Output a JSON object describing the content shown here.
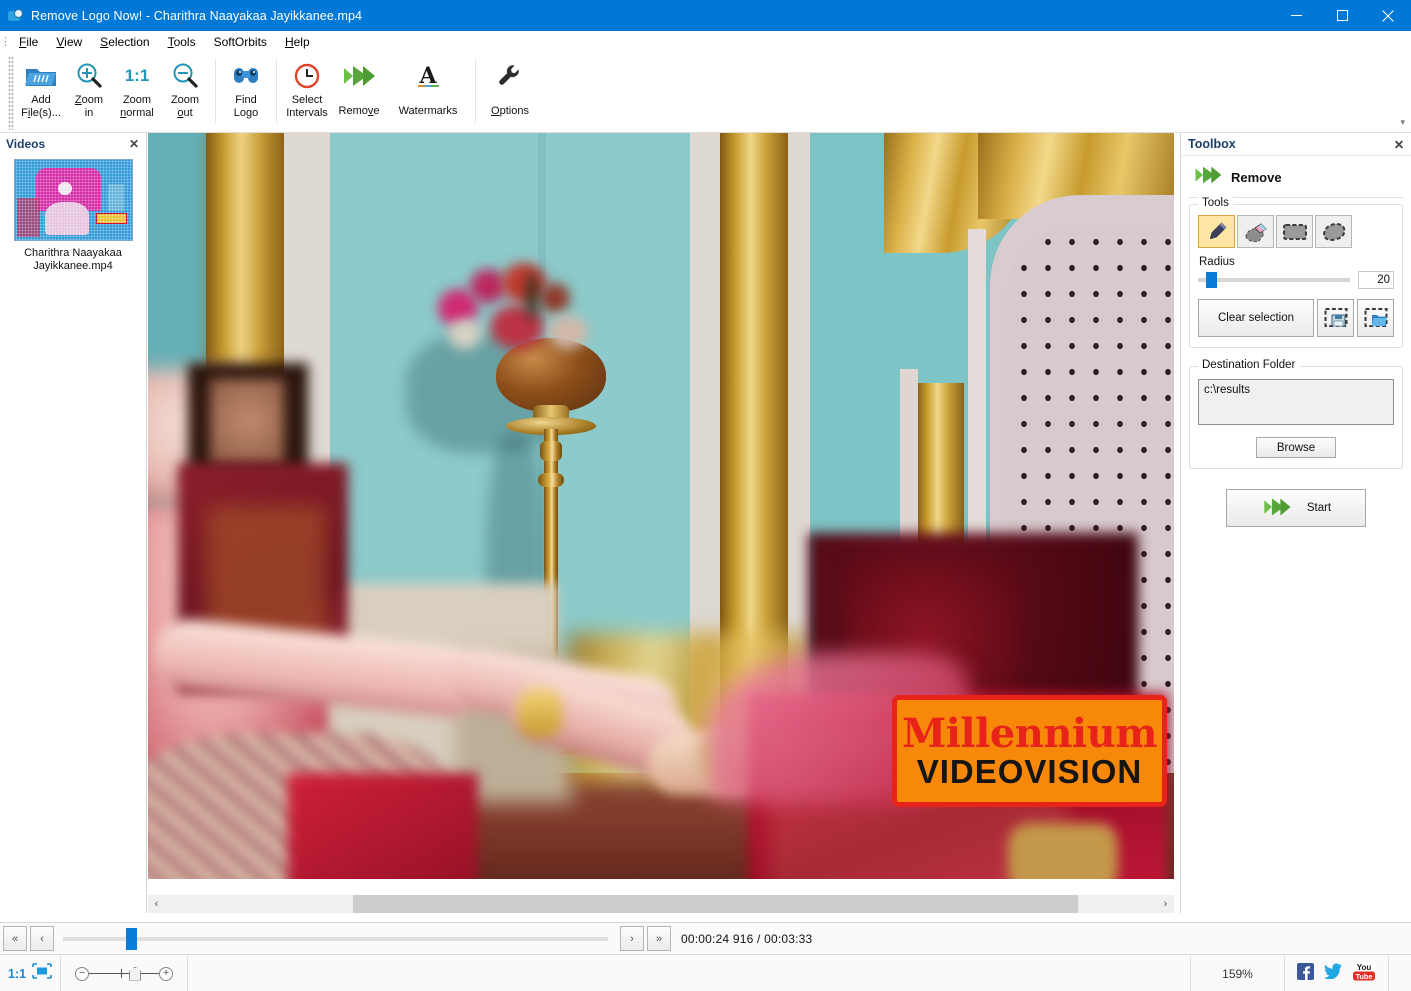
{
  "window": {
    "title": "Remove Logo Now! - Charithra Naayakaa Jayikkanee.mp4",
    "app_icon": "app-logo-icon",
    "minimize": "—",
    "maximize": "□",
    "close": "✕"
  },
  "menubar": {
    "grip": "⋮",
    "items": [
      {
        "label": "File",
        "accel": "F"
      },
      {
        "label": "View",
        "accel": "V"
      },
      {
        "label": "Selection",
        "accel": "S"
      },
      {
        "label": "Tools",
        "accel": "T"
      },
      {
        "label": "SoftOrbits",
        "accel": ""
      },
      {
        "label": "Help",
        "accel": "H"
      }
    ]
  },
  "toolbar": {
    "expand_glyph": "▾",
    "items": [
      {
        "id": "add-files",
        "line1": "Add",
        "line2": "File(s)...",
        "icon": "open-folder-icon"
      },
      {
        "id": "zoom-in",
        "line1": "Zoom",
        "line2": "in",
        "icon": "zoom-in-icon"
      },
      {
        "id": "zoom-normal",
        "line1": "Zoom",
        "line2": "normal",
        "icon": "zoom-1to1-icon"
      },
      {
        "id": "zoom-out",
        "line1": "Zoom",
        "line2": "out",
        "icon": "zoom-out-icon"
      },
      {
        "id": "find-logo",
        "line1": "Find",
        "line2": "Logo",
        "icon": "binoculars-icon"
      },
      {
        "id": "select-intervals",
        "line1": "Select",
        "line2": "Intervals",
        "icon": "clock-icon"
      },
      {
        "id": "remove",
        "line1": "Remove",
        "line2": "",
        "icon": "green-arrow-icon"
      },
      {
        "id": "watermarks",
        "line1": "Watermarks",
        "line2": "",
        "icon": "letter-a-icon"
      },
      {
        "id": "options",
        "line1": "Options",
        "line2": "",
        "icon": "wrench-icon"
      }
    ]
  },
  "videos_panel": {
    "title": "Videos",
    "close_glyph": "✕",
    "item": {
      "filename_line1": "Charithra Naayakaa",
      "filename_line2": "Jayikkanee.mp4"
    }
  },
  "canvas": {
    "scrollbar": {
      "left_glyph": "‹",
      "right_glyph": "›"
    },
    "watermark": {
      "line1": "Millennium",
      "line2": "VIDEOVISION",
      "bg_color": "#f7880a",
      "border_color": "#e8231a",
      "line1_color": "#e8231a",
      "line2_color": "#151515"
    }
  },
  "toolbox": {
    "title": "Toolbox",
    "close_glyph": "✕",
    "mode_label": "Remove",
    "mode_icon": "green-arrow-icon",
    "tools_group": {
      "legend": "Tools",
      "buttons": [
        {
          "id": "marker",
          "icon": "marker-pen-icon",
          "selected": true
        },
        {
          "id": "eraser",
          "icon": "eraser-icon",
          "selected": false
        },
        {
          "id": "rect-select",
          "icon": "rectangle-select-icon",
          "selected": false
        },
        {
          "id": "lasso-select",
          "icon": "lasso-select-icon",
          "selected": false
        }
      ],
      "radius_label": "Radius",
      "radius_value": "20",
      "clear_selection": "Clear selection",
      "save_selection_icon": "save-selection-icon",
      "load_selection_icon": "load-selection-icon"
    },
    "destination_group": {
      "legend": "Destination Folder",
      "path": "c:\\results",
      "browse": "Browse"
    },
    "start_button": {
      "label": "Start",
      "icon": "green-arrow-icon"
    }
  },
  "playbar": {
    "rewind_all": "«",
    "rewind": "‹",
    "forward": "›",
    "forward_all": "»",
    "time": "00:00:24 916 / 00:03:33"
  },
  "statusbar": {
    "fit_1to1": "1:1",
    "fit_screen_icon": "fit-to-screen-icon",
    "zoom_out_glyph": "−",
    "zoom_in_glyph": "+",
    "zoom_value": "159%",
    "social": [
      {
        "id": "facebook",
        "icon": "facebook-icon",
        "glyph": "f",
        "color": "#3b5998"
      },
      {
        "id": "twitter",
        "icon": "twitter-icon",
        "glyph": "t",
        "color": "#22a8e0"
      },
      {
        "id": "youtube",
        "icon": "youtube-icon",
        "line1": "You",
        "line2": "Tube",
        "color": "#e52d27"
      }
    ]
  }
}
